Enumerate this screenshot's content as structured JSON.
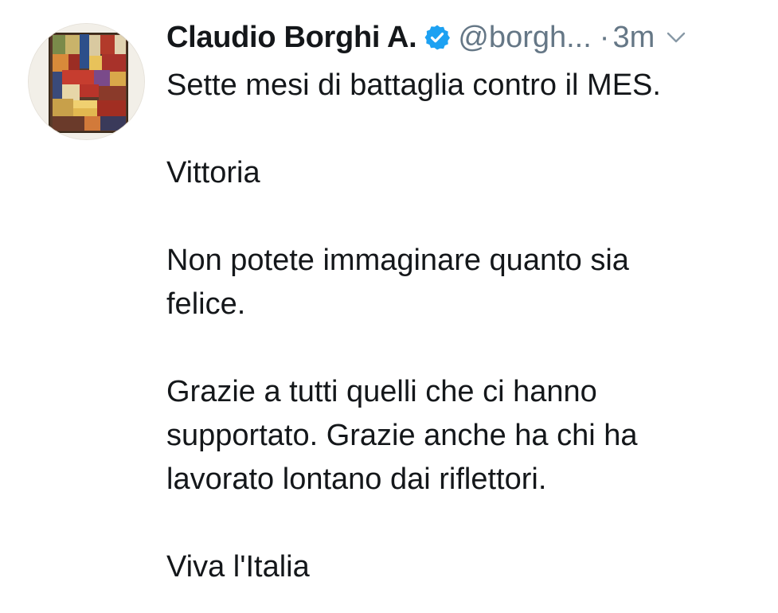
{
  "tweet": {
    "author": {
      "display_name": "Claudio Borghi A.",
      "handle": "@borgh...",
      "verified": true,
      "avatar_icon": "abstract-geometric-painting-avatar"
    },
    "separator": "·",
    "timestamp": "3m",
    "menu_icon": "chevron-down-icon",
    "paragraphs": [
      [
        "Sette mesi di battaglia contro il MES."
      ],
      [
        "Vittoria"
      ],
      [
        "Non potete immaginare quanto sia",
        "felice."
      ],
      [
        "Grazie a tutti quelli che ci hanno",
        "supportato. Grazie anche ha chi ha",
        "lavorato lontano dai riflettori."
      ],
      [
        "Viva l'Italia"
      ]
    ]
  },
  "colors": {
    "text": "#14171a",
    "muted": "#657786",
    "verified_blue": "#1da1f2",
    "background": "#ffffff"
  }
}
